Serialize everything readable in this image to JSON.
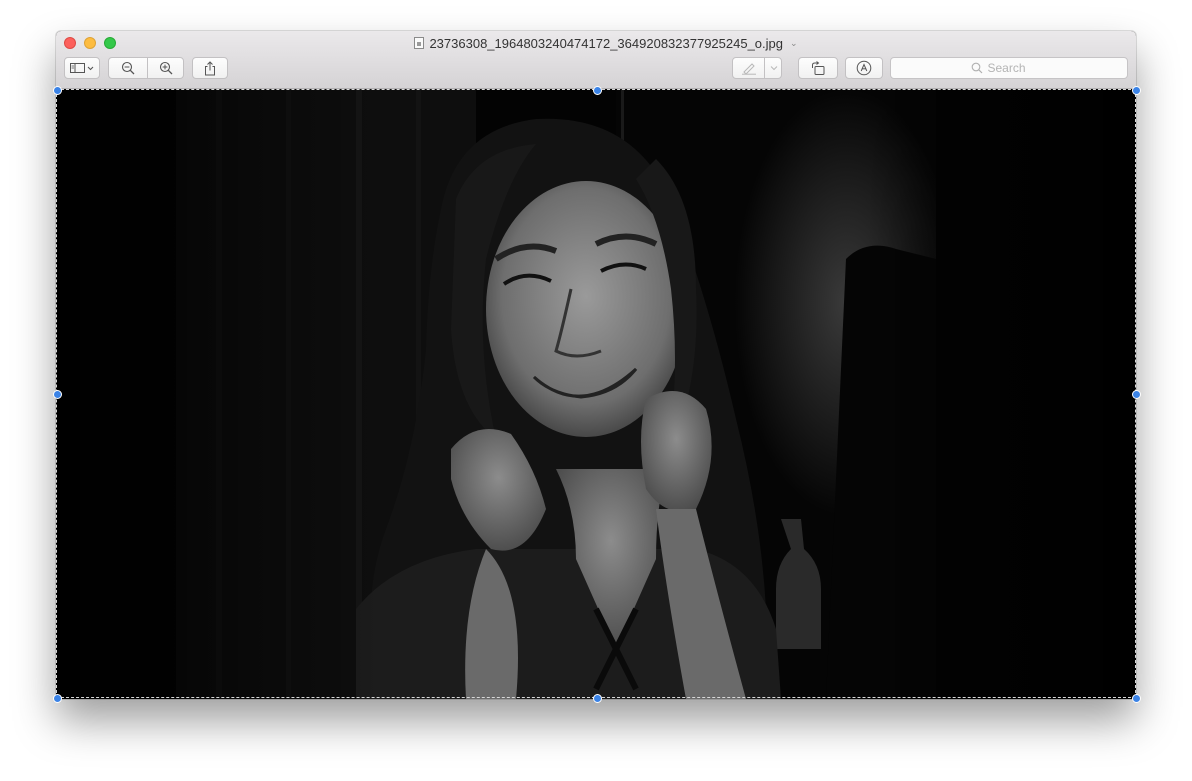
{
  "window": {
    "title": "23736308_1964803240474172_364920832377925245_o.jpg",
    "title_chevron": "⌄"
  },
  "toolbar": {
    "sidebar_icon": "sidebar-toggle-icon",
    "zoom_out_icon": "zoom-out-icon",
    "zoom_in_icon": "zoom-in-icon",
    "share_icon": "share-icon",
    "markup_icon": "pen-icon",
    "rotate_icon": "rotate-left-icon",
    "annotate_icon": "markup-circle-icon"
  },
  "search": {
    "placeholder": "Search",
    "icon": "search-icon"
  },
  "image": {
    "description_icon": "photo"
  },
  "colors": {
    "close": "#fc605c",
    "minimize": "#fdbc40",
    "maximize": "#34c84a",
    "selection_handle": "#3b83e6"
  }
}
